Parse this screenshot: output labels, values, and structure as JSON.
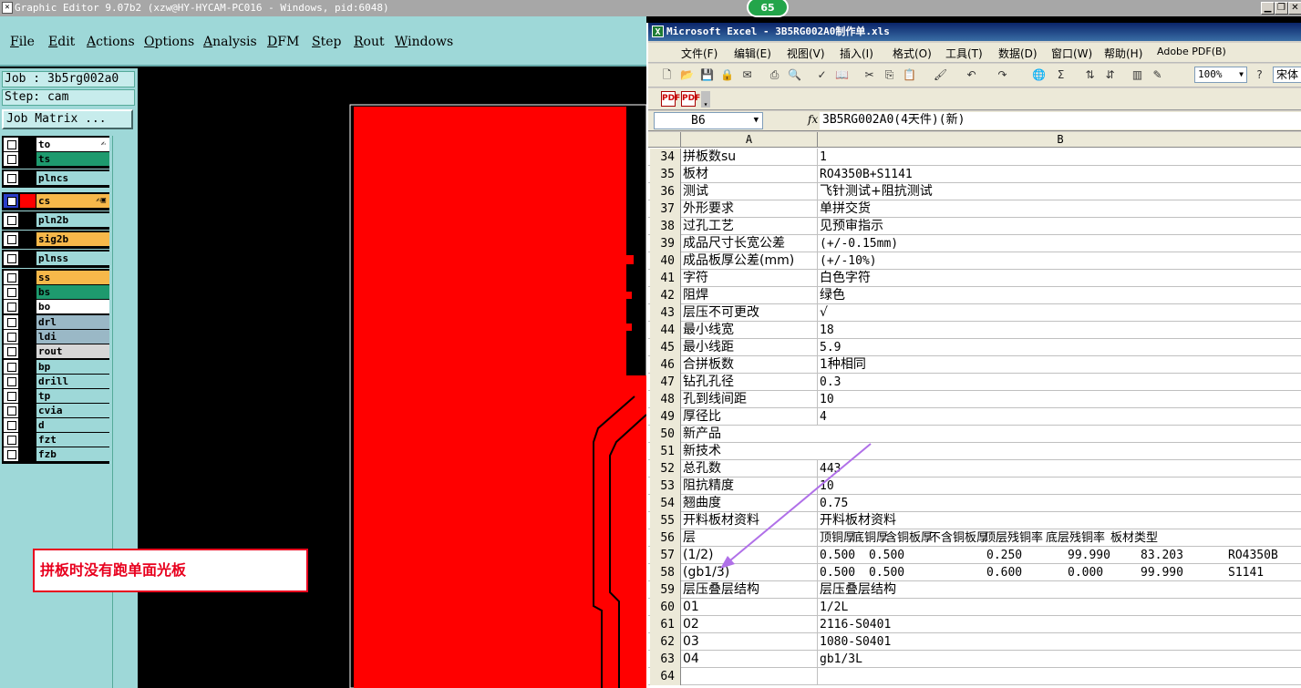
{
  "graphic_editor": {
    "title": "Graphic Editor 9.07b2 (xzw@HY-HYCAM-PC016 - Windows, pid:6048)",
    "badge": "65",
    "menu": [
      "File",
      "Edit",
      "Actions",
      "Options",
      "Analysis",
      "DFM",
      "Step",
      "Rout",
      "Windows"
    ],
    "job": "Job : 3b5rg002a0",
    "step": "Step: cam",
    "job_matrix_button": "Job Matrix ...",
    "layer_groups": [
      [
        {
          "name": "to",
          "color": "#ffffff",
          "flag": "✍"
        },
        {
          "name": "ts",
          "color": "#1e9a6e",
          "flag": ""
        }
      ],
      [
        {
          "name": "plncs",
          "color": "#9ed8d8",
          "flag": ""
        }
      ],
      [
        {
          "name": "cs",
          "color": "#f7b84a",
          "flag": "✍▣",
          "active": true,
          "swatch": "#ff0000"
        }
      ],
      [
        {
          "name": "pln2b",
          "color": "#9ed8d8",
          "flag": ""
        }
      ],
      [
        {
          "name": "sig2b",
          "color": "#f7b84a",
          "flag": ""
        }
      ],
      [
        {
          "name": "plnss",
          "color": "#9ed8d8",
          "flag": ""
        }
      ],
      [
        {
          "name": "ss",
          "color": "#f7b84a",
          "flag": ""
        },
        {
          "name": "bs",
          "color": "#1e9a6e",
          "flag": ""
        },
        {
          "name": "bo",
          "color": "#ffffff",
          "flag": ""
        }
      ],
      [
        {
          "name": "drl",
          "color": "#9ab8c6",
          "flag": ""
        },
        {
          "name": "ldi",
          "color": "#9ab8c6",
          "flag": ""
        },
        {
          "name": "rout",
          "color": "#d7d7d7",
          "flag": ""
        }
      ],
      [
        {
          "name": "bp",
          "color": "#9ed8d8",
          "flag": ""
        },
        {
          "name": "drill",
          "color": "#9ed8d8",
          "flag": ""
        },
        {
          "name": "tp",
          "color": "#9ed8d8",
          "flag": ""
        },
        {
          "name": "cvia",
          "color": "#9ed8d8",
          "flag": ""
        },
        {
          "name": "d",
          "color": "#9ed8d8",
          "flag": ""
        },
        {
          "name": "fzt",
          "color": "#9ed8d8",
          "flag": ""
        },
        {
          "name": "fzb",
          "color": "#9ed8d8",
          "flag": ""
        }
      ]
    ],
    "note": "拼板时没有跑单面光板"
  },
  "excel": {
    "title": "Microsoft Excel - 3B5RG002A0制作单.xls",
    "menu": [
      "文件(F)",
      "编辑(E)",
      "视图(V)",
      "插入(I)",
      "格式(O)",
      "工具(T)",
      "数据(D)",
      "窗口(W)",
      "帮助(H)",
      "Adobe PDF(B)"
    ],
    "zoom": "100%",
    "font": "宋体",
    "name_box": "B6",
    "fx": "fx",
    "formula": "3B5RG002A0(4天件)(新)",
    "columns": [
      "A",
      "B"
    ],
    "rows": [
      {
        "n": "34",
        "a": "拼板数su",
        "b": "1"
      },
      {
        "n": "35",
        "a": "板材",
        "b": "RO4350B+S1141"
      },
      {
        "n": "36",
        "a": "测试",
        "b": "飞针测试+阻抗测试"
      },
      {
        "n": "37",
        "a": "外形要求",
        "b": "单拼交货"
      },
      {
        "n": "38",
        "a": "过孔工艺",
        "b": "见预审指示"
      },
      {
        "n": "39",
        "a": "成品尺寸长宽公差",
        "b": "(+/-0.15mm)"
      },
      {
        "n": "40",
        "a": "成品板厚公差(mm)",
        "b": "(+/-10%)"
      },
      {
        "n": "41",
        "a": "字符",
        "b": "白色字符"
      },
      {
        "n": "42",
        "a": "阻焊",
        "b": "绿色"
      },
      {
        "n": "43",
        "a": "层压不可更改",
        "b": "√"
      },
      {
        "n": "44",
        "a": "最小线宽",
        "b": "18"
      },
      {
        "n": "45",
        "a": "最小线距",
        "b": "5.9"
      },
      {
        "n": "46",
        "a": "合拼板数",
        "b": "1种相同"
      },
      {
        "n": "47",
        "a": "钻孔孔径",
        "b": "0.3"
      },
      {
        "n": "48",
        "a": "孔到线间距",
        "b": "10"
      },
      {
        "n": "49",
        "a": "厚径比",
        "b": "4"
      },
      {
        "n": "50",
        "a": "新产品",
        "b": ""
      },
      {
        "n": "51",
        "a": "新技术",
        "b": ""
      },
      {
        "n": "52",
        "a": "总孔数",
        "b": "443"
      },
      {
        "n": "53",
        "a": "阻抗精度",
        "b": "10"
      },
      {
        "n": "54",
        "a": "翘曲度",
        "b": "0.75"
      },
      {
        "n": "55",
        "a": "开料板材资料",
        "b": "开料板材资料"
      },
      {
        "n": "56",
        "a": "层",
        "b": ""
      },
      {
        "n": "57",
        "a": "(1/2)",
        "b": ""
      },
      {
        "n": "58",
        "a": "(gb1/3)",
        "b": ""
      },
      {
        "n": "59",
        "a": "层压叠层结构",
        "b": "层压叠层结构"
      },
      {
        "n": "60",
        "a": "01",
        "b": "1/2L"
      },
      {
        "n": "61",
        "a": "02",
        "b": "2116-S0401"
      },
      {
        "n": "62",
        "a": "03",
        "b": "1080-S0401"
      },
      {
        "n": "63",
        "a": "04",
        "b": "gb1/3L"
      },
      {
        "n": "64",
        "a": "",
        "b": ""
      }
    ],
    "material_table": {
      "headers": [
        "顶铜厚",
        "底铜厚",
        "含铜板厚",
        "不含铜板厚",
        "顶层残铜率",
        "底层残铜率",
        "板材类型"
      ],
      "rows": [
        [
          "0.500",
          "0.500",
          "",
          "0.250",
          "99.990",
          "83.203",
          "RO4350B"
        ],
        [
          "0.500",
          "0.500",
          "",
          "0.600",
          "0.000",
          "99.990",
          "S1141"
        ]
      ]
    }
  }
}
